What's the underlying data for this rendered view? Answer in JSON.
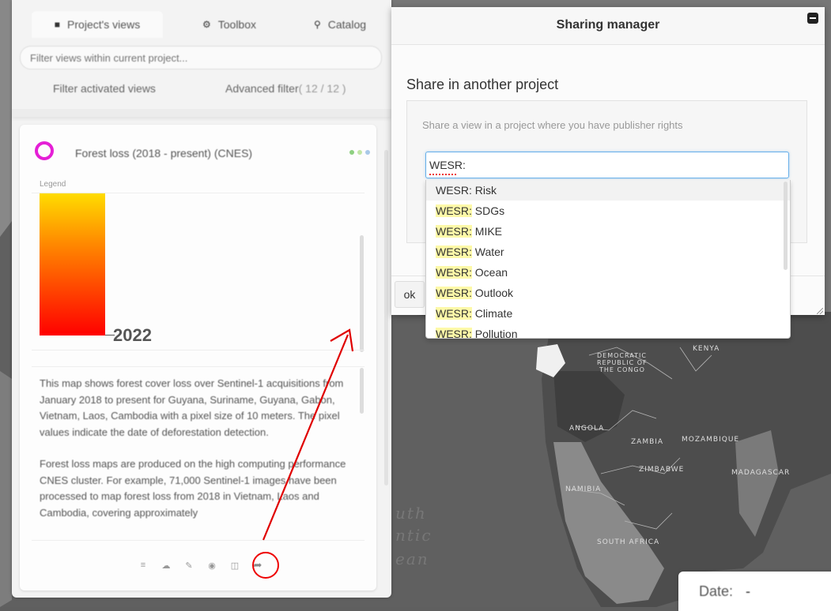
{
  "tabs": [
    {
      "label": "Project's views",
      "icon": "folder-icon"
    },
    {
      "label": "Toolbox",
      "icon": "gear-icon"
    },
    {
      "label": "Catalog",
      "icon": "search-icon"
    }
  ],
  "filter": {
    "placeholder": "Filter views within current project...",
    "activated_label": "Filter activated views",
    "advanced_label": "Advanced filter",
    "advanced_count": "( 12 / 12 )"
  },
  "view": {
    "title": "Forest loss (2018 - present) (CNES)",
    "ring_color": "#e51fd6",
    "status_colors": [
      "#8ed081",
      "#c2e6a6",
      "#a9c9e8"
    ],
    "legend_label": "Legend",
    "legend_year": "2022",
    "legend_colors": [
      "#ffdc00",
      "#ff8a00",
      "#ff0000"
    ],
    "description": [
      "This map shows forest cover loss over Sentinel-1 acquisitions from January 2018 to present for Guyana, Suriname, Guyana, Gabon, Vietnam, Laos, Cambodia with a pixel size of 10 meters. The pixel values indicate the date of deforestation detection.",
      "Forest loss maps are produced on the high computing performance CNES cluster. For example, 71,000 Sentinel-1 images have been processed to map forest loss from 2018 in Vietnam, Laos and Cambodia, covering approximately"
    ],
    "toolbar_icons": [
      "sliders-icon",
      "cloud-icon",
      "pencil-icon",
      "palette-icon",
      "trash-icon",
      "share-icon"
    ]
  },
  "modal": {
    "title": "Sharing manager",
    "section_title": "Share in another project",
    "hint": "Share a view in a project where you have publisher rights",
    "search_value": "WESR:",
    "ok_label": "ok"
  },
  "dropdown": {
    "match": "WESR:",
    "options": [
      {
        "prefix": "WESR:",
        "rest": " Risk"
      },
      {
        "prefix": "WESR:",
        "rest": " SDGs"
      },
      {
        "prefix": "WESR:",
        "rest": " MIKE"
      },
      {
        "prefix": "WESR:",
        "rest": " Water"
      },
      {
        "prefix": "WESR:",
        "rest": " Ocean"
      },
      {
        "prefix": "WESR:",
        "rest": " Outlook"
      },
      {
        "prefix": "WESR:",
        "rest": " Climate"
      },
      {
        "prefix": "WESR:",
        "rest": " Pollution"
      }
    ]
  },
  "map": {
    "country_labels": [
      "KENYA",
      "DEMOCRATIC",
      "REPUBLIC OF",
      "THE CONGO",
      "ANGOLA",
      "ZAMBIA",
      "MOZAMBIQUE",
      "ZIMBABWE",
      "NAMIBIA",
      "MADAGASCAR",
      "SOUTH AFRICA"
    ],
    "ocean_fragments": [
      "uth",
      "ntic",
      "ean"
    ]
  },
  "date": {
    "label": "Date:",
    "value": "-"
  },
  "annotation": {
    "color": "#e00000"
  }
}
